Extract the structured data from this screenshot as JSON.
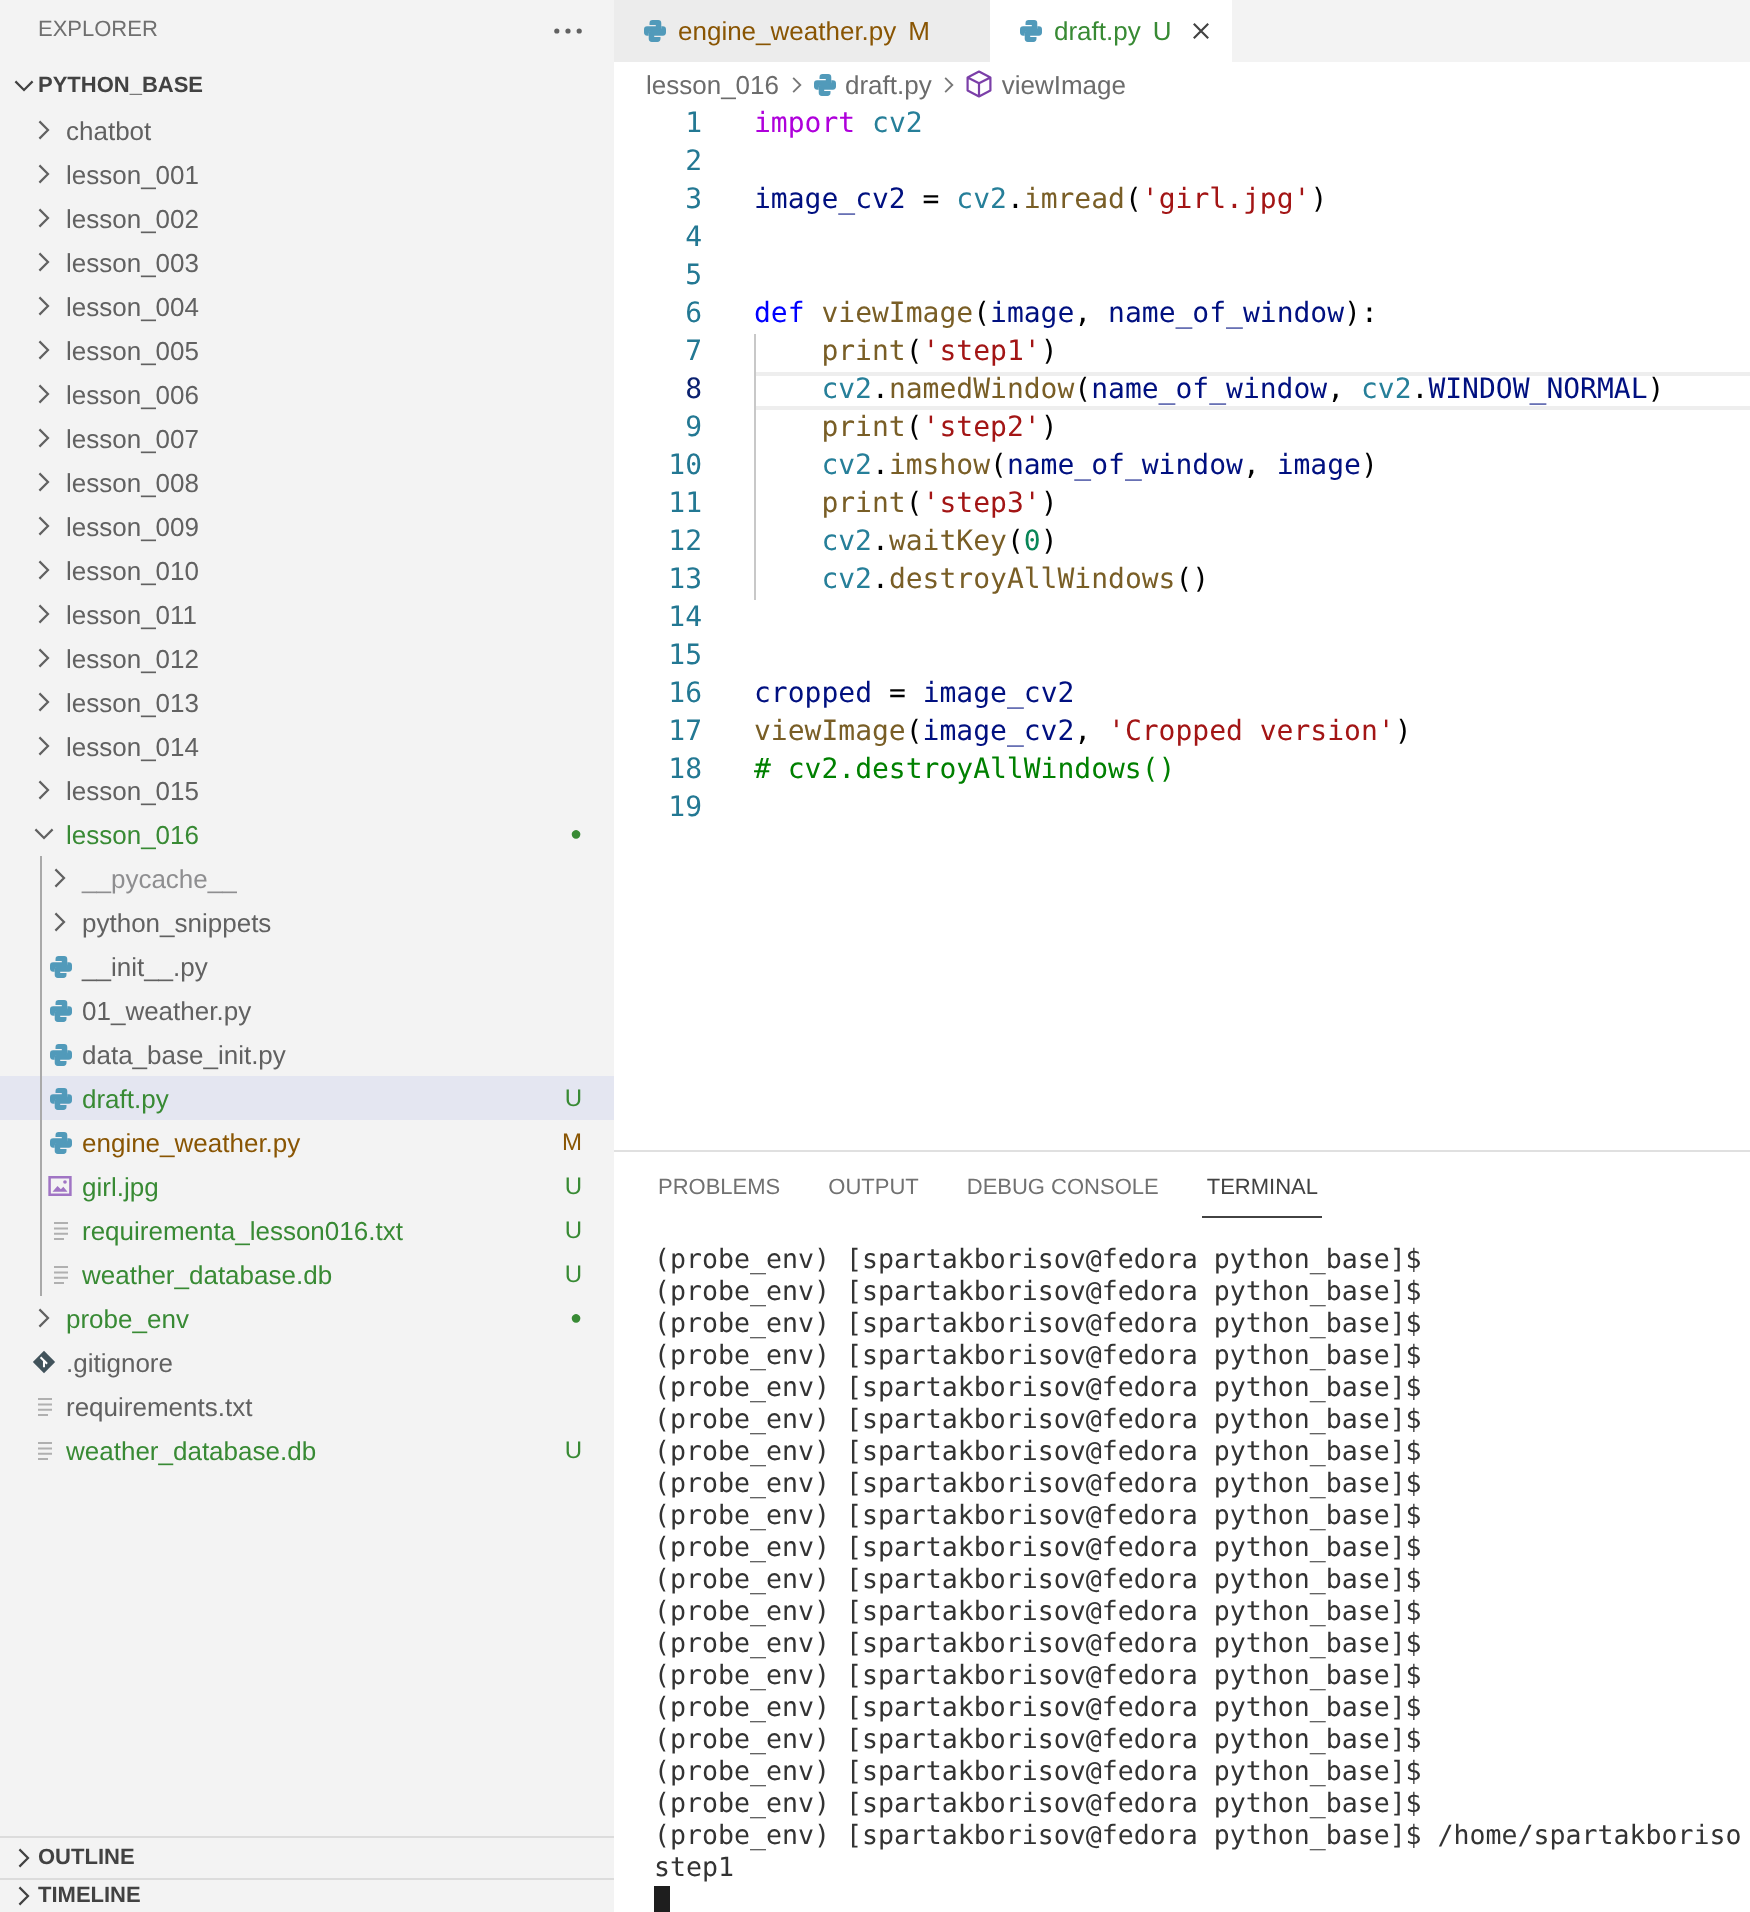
{
  "sidebar": {
    "title": "EXPLORER",
    "root": {
      "name": "PYTHON_BASE",
      "expanded": true
    },
    "tree": [
      {
        "name": "chatbot",
        "kind": "folder",
        "expanded": false,
        "selected": false
      },
      {
        "name": "lesson_001",
        "kind": "folder",
        "expanded": false,
        "selected": false
      },
      {
        "name": "lesson_002",
        "kind": "folder",
        "expanded": false,
        "selected": false
      },
      {
        "name": "lesson_003",
        "kind": "folder",
        "expanded": false,
        "selected": false
      },
      {
        "name": "lesson_004",
        "kind": "folder",
        "expanded": false,
        "selected": false
      },
      {
        "name": "lesson_005",
        "kind": "folder",
        "expanded": false,
        "selected": false
      },
      {
        "name": "lesson_006",
        "kind": "folder",
        "expanded": false,
        "selected": false
      },
      {
        "name": "lesson_007",
        "kind": "folder",
        "expanded": false,
        "selected": false
      },
      {
        "name": "lesson_008",
        "kind": "folder",
        "expanded": false,
        "selected": false
      },
      {
        "name": "lesson_009",
        "kind": "folder",
        "expanded": false,
        "selected": false
      },
      {
        "name": "lesson_010",
        "kind": "folder",
        "expanded": false,
        "selected": false
      },
      {
        "name": "lesson_011",
        "kind": "folder",
        "expanded": false,
        "selected": false
      },
      {
        "name": "lesson_012",
        "kind": "folder",
        "expanded": false,
        "selected": false
      },
      {
        "name": "lesson_013",
        "kind": "folder",
        "expanded": false,
        "selected": false
      },
      {
        "name": "lesson_014",
        "kind": "folder",
        "expanded": false,
        "selected": false
      },
      {
        "name": "lesson_015",
        "kind": "folder",
        "expanded": false,
        "selected": false
      },
      {
        "name": "lesson_016",
        "kind": "folder",
        "expanded": true,
        "selected": false,
        "color": "#388a34",
        "badge": "●",
        "children": [
          {
            "name": "__pycache__",
            "kind": "folder",
            "expanded": false,
            "selected": false,
            "color": "#8e8e90"
          },
          {
            "name": "python_snippets",
            "kind": "folder",
            "expanded": false,
            "selected": false
          },
          {
            "name": "__init__.py",
            "kind": "python",
            "selected": false
          },
          {
            "name": "01_weather.py",
            "kind": "python",
            "selected": false
          },
          {
            "name": "data_base_init.py",
            "kind": "python",
            "selected": false
          },
          {
            "name": "draft.py",
            "kind": "python",
            "selected": true,
            "color": "#388a34",
            "badge": "U"
          },
          {
            "name": "engine_weather.py",
            "kind": "python",
            "selected": false,
            "color": "#895503",
            "badge": "M"
          },
          {
            "name": "girl.jpg",
            "kind": "image",
            "selected": false,
            "color": "#388a34",
            "badge": "U"
          },
          {
            "name": "requirementa_lesson016.txt",
            "kind": "text",
            "selected": false,
            "color": "#388a34",
            "badge": "U"
          },
          {
            "name": "weather_database.db",
            "kind": "text",
            "selected": false,
            "color": "#388a34",
            "badge": "U"
          }
        ]
      },
      {
        "name": "probe_env",
        "kind": "folder",
        "expanded": false,
        "selected": false,
        "color": "#388a34",
        "badge": "●"
      },
      {
        "name": ".gitignore",
        "kind": "git",
        "selected": false
      },
      {
        "name": "requirements.txt",
        "kind": "text",
        "selected": false
      },
      {
        "name": "weather_database.db",
        "kind": "text",
        "selected": false,
        "color": "#388a34",
        "badge": "U"
      }
    ],
    "sections": [
      {
        "title": "OUTLINE",
        "expanded": false
      },
      {
        "title": "TIMELINE",
        "expanded": false
      }
    ]
  },
  "editor": {
    "tabs": [
      {
        "label": "engine_weather.py",
        "kind": "python",
        "color": "#895503",
        "badge": "M",
        "selected": false
      },
      {
        "label": "draft.py",
        "kind": "python",
        "color": "#388a34",
        "badge": "U",
        "selected": true
      }
    ],
    "breadcrumb": [
      {
        "kind": "folder",
        "label": "lesson_016"
      },
      {
        "kind": "python",
        "label": "draft.py"
      },
      {
        "kind": "method",
        "label": "viewImage"
      }
    ],
    "lines": [
      {
        "number": "1",
        "current": false,
        "tokens": [
          {
            "kind": "control",
            "text": "import "
          },
          {
            "kind": "type",
            "text": "cv2"
          }
        ]
      },
      {
        "number": "2",
        "current": false
      },
      {
        "number": "3",
        "current": false,
        "tokens": [
          {
            "kind": "variable",
            "text": "image_cv2"
          },
          {
            "kind": "plain",
            "text": " = "
          },
          {
            "kind": "type",
            "text": "cv2"
          },
          {
            "kind": "plain",
            "text": "."
          },
          {
            "kind": "function",
            "text": "imread"
          },
          {
            "kind": "plain",
            "text": "("
          },
          {
            "kind": "string",
            "text": "'girl.jpg'"
          },
          {
            "kind": "plain",
            "text": ")"
          }
        ]
      },
      {
        "number": "4",
        "current": false
      },
      {
        "number": "5",
        "current": false
      },
      {
        "number": "6",
        "current": false,
        "tokens": [
          {
            "kind": "keyword",
            "text": "def "
          },
          {
            "kind": "function",
            "text": "viewImage"
          },
          {
            "kind": "plain",
            "text": "("
          },
          {
            "kind": "variable",
            "text": "image"
          },
          {
            "kind": "plain",
            "text": ", "
          },
          {
            "kind": "variable",
            "text": "name_of_window"
          },
          {
            "kind": "plain",
            "text": "):"
          }
        ],
        "children": [
          {
            "number": "7",
            "current": false,
            "tokens": [
              {
                "kind": "function",
                "text": "print"
              },
              {
                "kind": "plain",
                "text": "("
              },
              {
                "kind": "string",
                "text": "'step1'"
              },
              {
                "kind": "plain",
                "text": ")"
              }
            ]
          },
          {
            "number": "8",
            "current": true,
            "tokens": [
              {
                "kind": "type",
                "text": "cv2"
              },
              {
                "kind": "plain",
                "text": "."
              },
              {
                "kind": "function",
                "text": "namedWindow"
              },
              {
                "kind": "plain",
                "text": "("
              },
              {
                "kind": "variable",
                "text": "name_of_window"
              },
              {
                "kind": "plain",
                "text": ", "
              },
              {
                "kind": "type",
                "text": "cv2"
              },
              {
                "kind": "plain",
                "text": "."
              },
              {
                "kind": "variable",
                "text": "WINDOW_NORMAL"
              },
              {
                "kind": "plain",
                "text": ")"
              }
            ]
          },
          {
            "number": "9",
            "current": false,
            "tokens": [
              {
                "kind": "function",
                "text": "print"
              },
              {
                "kind": "plain",
                "text": "("
              },
              {
                "kind": "string",
                "text": "'step2'"
              },
              {
                "kind": "plain",
                "text": ")"
              }
            ]
          },
          {
            "number": "10",
            "current": false,
            "tokens": [
              {
                "kind": "type",
                "text": "cv2"
              },
              {
                "kind": "plain",
                "text": "."
              },
              {
                "kind": "function",
                "text": "imshow"
              },
              {
                "kind": "plain",
                "text": "("
              },
              {
                "kind": "variable",
                "text": "name_of_window"
              },
              {
                "kind": "plain",
                "text": ", "
              },
              {
                "kind": "variable",
                "text": "image"
              },
              {
                "kind": "plain",
                "text": ")"
              }
            ]
          },
          {
            "number": "11",
            "current": false,
            "tokens": [
              {
                "kind": "function",
                "text": "print"
              },
              {
                "kind": "plain",
                "text": "("
              },
              {
                "kind": "string",
                "text": "'step3'"
              },
              {
                "kind": "plain",
                "text": ")"
              }
            ]
          },
          {
            "number": "12",
            "current": false,
            "tokens": [
              {
                "kind": "type",
                "text": "cv2"
              },
              {
                "kind": "plain",
                "text": "."
              },
              {
                "kind": "function",
                "text": "waitKey"
              },
              {
                "kind": "plain",
                "text": "("
              },
              {
                "kind": "number",
                "text": "0"
              },
              {
                "kind": "plain",
                "text": ")"
              }
            ]
          },
          {
            "number": "13",
            "current": false,
            "tokens": [
              {
                "kind": "type",
                "text": "cv2"
              },
              {
                "kind": "plain",
                "text": "."
              },
              {
                "kind": "function",
                "text": "destroyAllWindows"
              },
              {
                "kind": "plain",
                "text": "()"
              }
            ]
          }
        ]
      },
      {
        "number": "14",
        "current": false
      },
      {
        "number": "15",
        "current": false
      },
      {
        "number": "16",
        "current": false,
        "tokens": [
          {
            "kind": "variable",
            "text": "cropped"
          },
          {
            "kind": "plain",
            "text": " = "
          },
          {
            "kind": "variable",
            "text": "image_cv2"
          }
        ]
      },
      {
        "number": "17",
        "current": false,
        "tokens": [
          {
            "kind": "function",
            "text": "viewImage"
          },
          {
            "kind": "plain",
            "text": "("
          },
          {
            "kind": "variable",
            "text": "image_cv2"
          },
          {
            "kind": "plain",
            "text": ", "
          },
          {
            "kind": "string",
            "text": "'Cropped version'"
          },
          {
            "kind": "plain",
            "text": ")"
          }
        ]
      },
      {
        "number": "18",
        "current": false,
        "tokens": [
          {
            "kind": "comment",
            "text": "# cv2.destroyAllWindows()"
          }
        ]
      },
      {
        "number": "19",
        "current": false
      }
    ]
  },
  "panel": {
    "tabs": [
      {
        "label": "PROBLEMS",
        "selected": false
      },
      {
        "label": "OUTPUT",
        "selected": false
      },
      {
        "label": "DEBUG CONSOLE",
        "selected": false
      },
      {
        "label": "TERMINAL",
        "selected": true
      }
    ],
    "terminal": {
      "lines": [
        "(probe_env) [spartakborisov@fedora python_base]$",
        "(probe_env) [spartakborisov@fedora python_base]$",
        "(probe_env) [spartakborisov@fedora python_base]$",
        "(probe_env) [spartakborisov@fedora python_base]$",
        "(probe_env) [spartakborisov@fedora python_base]$",
        "(probe_env) [spartakborisov@fedora python_base]$",
        "(probe_env) [spartakborisov@fedora python_base]$",
        "(probe_env) [spartakborisov@fedora python_base]$",
        "(probe_env) [spartakborisov@fedora python_base]$",
        "(probe_env) [spartakborisov@fedora python_base]$",
        "(probe_env) [spartakborisov@fedora python_base]$",
        "(probe_env) [spartakborisov@fedora python_base]$",
        "(probe_env) [spartakborisov@fedora python_base]$",
        "(probe_env) [spartakborisov@fedora python_base]$",
        "(probe_env) [spartakborisov@fedora python_base]$",
        "(probe_env) [spartakborisov@fedora python_base]$",
        "(probe_env) [spartakborisov@fedora python_base]$",
        "(probe_env) [spartakborisov@fedora python_base]$",
        "(probe_env) [spartakborisov@fedora python_base]$ /home/spartakboriso",
        "step1"
      ],
      "cursor": true
    }
  }
}
